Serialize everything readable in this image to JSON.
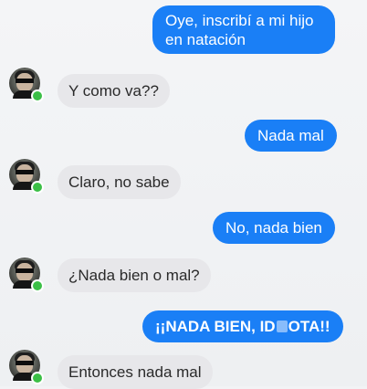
{
  "messages": [
    {
      "text_line1": "Oye, inscribí a mi hijo",
      "text_line2": "en natación"
    },
    {
      "text": "Y como va??"
    },
    {
      "text": "Nada mal"
    },
    {
      "text": "Claro, no sabe"
    },
    {
      "text": "No, nada bien"
    },
    {
      "text": "¿Nada bien o mal?"
    },
    {
      "text_part1": "¡¡NADA BIEN, ID",
      "text_part2": "OTA!!"
    },
    {
      "text": "Entonces nada mal"
    }
  ],
  "colors": {
    "outgoing_bubble": "#1a7ff6",
    "incoming_bubble": "#e7e7ea",
    "online_dot": "#3bbf46"
  }
}
